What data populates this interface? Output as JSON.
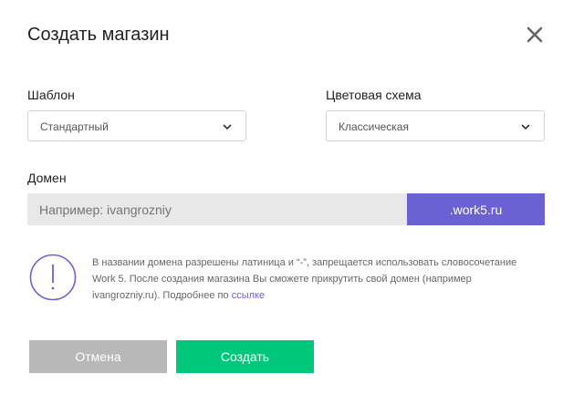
{
  "dialog": {
    "title": "Создать магазин"
  },
  "template": {
    "label": "Шаблон",
    "selected": "Стандартный"
  },
  "color_scheme": {
    "label": "Цветовая схема",
    "selected": "Классическая"
  },
  "domain": {
    "label": "Домен",
    "placeholder": "Например: ivangrozniy",
    "value": "",
    "suffix": ".work5.ru"
  },
  "note": {
    "text": "В названии домена разрешены латиница и “-”, запрещается использовать словосочетание Work 5. После создания магазина Вы сможете прикрутить свой домен (например ivangrozniy.ru). Подробнее по",
    "link_text": "ссылке"
  },
  "buttons": {
    "cancel_label": "Отмена",
    "create_label": "Создать"
  },
  "colors": {
    "accent": "#6a62d2",
    "create": "#00c779",
    "cancel": "#b8b8b8"
  },
  "icons": {
    "close": "close-icon",
    "chevron": "chevron-down-icon",
    "warning": "exclamation-circle-icon"
  }
}
